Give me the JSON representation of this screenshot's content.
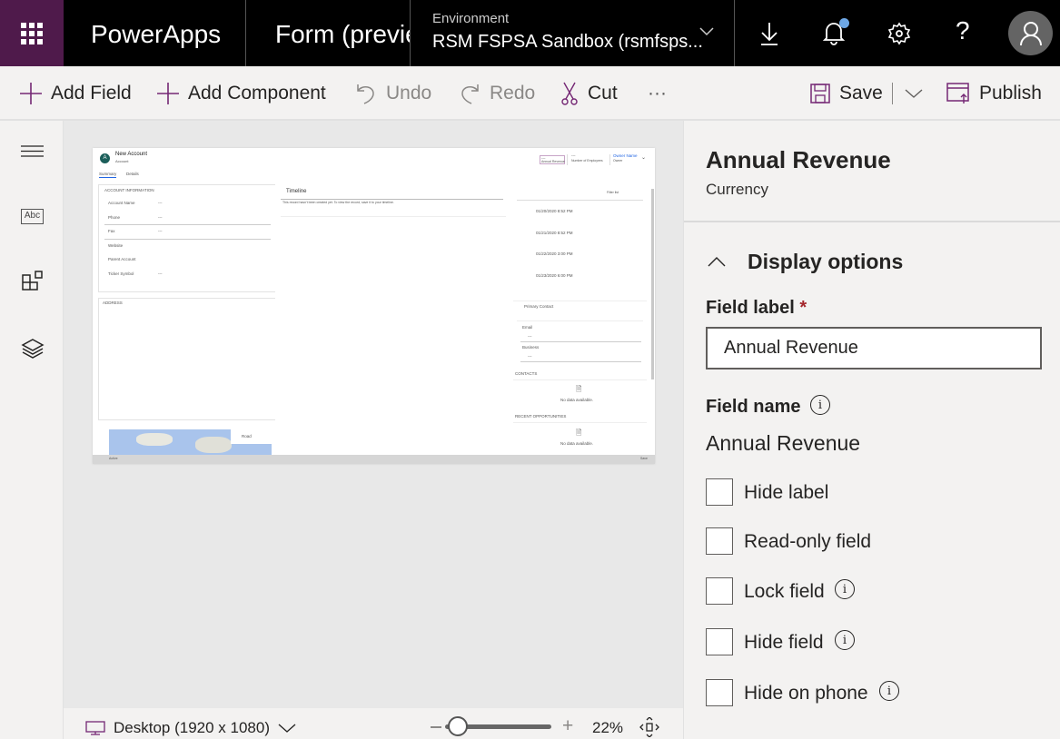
{
  "topbar": {
    "app_name": "PowerApps",
    "page_title": "Form (preview)",
    "environment_label": "Environment",
    "environment_value": "RSM FSPSA Sandbox (rsmfsps...",
    "icons": [
      "waffle-icon",
      "download-icon",
      "bell-icon",
      "gear-icon",
      "help-icon",
      "user-icon"
    ],
    "notification_dot_color": "#6ea8e6",
    "brand_color": "#4f1a4b"
  },
  "toolbar": {
    "add_field": "Add Field",
    "add_component": "Add Component",
    "undo": "Undo",
    "redo": "Redo",
    "cut": "Cut",
    "more": "···",
    "save": "Save",
    "publish": "Publish",
    "accent_color": "#742774"
  },
  "leftrail": {
    "icons": [
      "hamburger-icon",
      "fields-icon",
      "components-icon",
      "tree-view-icon"
    ],
    "fields_glyph": "Abc"
  },
  "preview": {
    "title": "New Account",
    "entity": "Account",
    "tabs": [
      "Summary",
      "Details"
    ],
    "header_fields": [
      {
        "value": "---",
        "label": "Annual Revenue"
      },
      {
        "value": "---",
        "label": "Number of Employees"
      },
      {
        "value": "Owner Name",
        "label": "Owner"
      }
    ],
    "section_title": "ACCOUNT INFORMATION",
    "fields": [
      {
        "label": "Account Name",
        "value": "---"
      },
      {
        "label": "Phone",
        "value": "---"
      },
      {
        "label": "Fax",
        "value": "---"
      },
      {
        "label": "Website",
        "value": ""
      },
      {
        "label": "Parent Account",
        "value": ""
      },
      {
        "label": "Ticker Symbol",
        "value": "---"
      }
    ],
    "address_title": "ADDRESS",
    "timeline_title": "Timeline",
    "timeline_text": "This record hasn't been created yet. To view the record, save it to your timeline.",
    "assistant_filter": "Filter list",
    "dates": [
      "01/20/2020 8:52 PM",
      "01/21/2020 8:52 PM",
      "01/22/2020 3:00 PM",
      "01/23/2020 6:00 PM"
    ],
    "primary_contact": "Primary Contact",
    "contact_fields": [
      {
        "label": "Email",
        "value": "---"
      },
      {
        "label": "Business",
        "value": "---"
      }
    ],
    "contacts_title": "CONTACTS",
    "opportunities_title": "RECENT OPPORTUNITIES",
    "no_data": "No data available.",
    "map_style": "Road",
    "status": "Active",
    "status_save": "Save"
  },
  "bottombar": {
    "device": "Desktop (1920 x 1080)",
    "zoom_percent": 22,
    "zoom_label": "22%"
  },
  "panel": {
    "title": "Annual Revenue",
    "subtitle": "Currency",
    "section": "Display options",
    "field_label_label": "Field label",
    "required_mark": "*",
    "field_label_value": "Annual Revenue",
    "field_name_label": "Field name",
    "field_name_value": "Annual Revenue",
    "checkboxes": [
      {
        "label": "Hide label",
        "checked": false,
        "info": false
      },
      {
        "label": "Read-only field",
        "checked": false,
        "info": false
      },
      {
        "label": "Lock field",
        "checked": false,
        "info": true
      },
      {
        "label": "Hide field",
        "checked": false,
        "info": true
      },
      {
        "label": "Hide on phone",
        "checked": false,
        "info": true
      }
    ]
  }
}
